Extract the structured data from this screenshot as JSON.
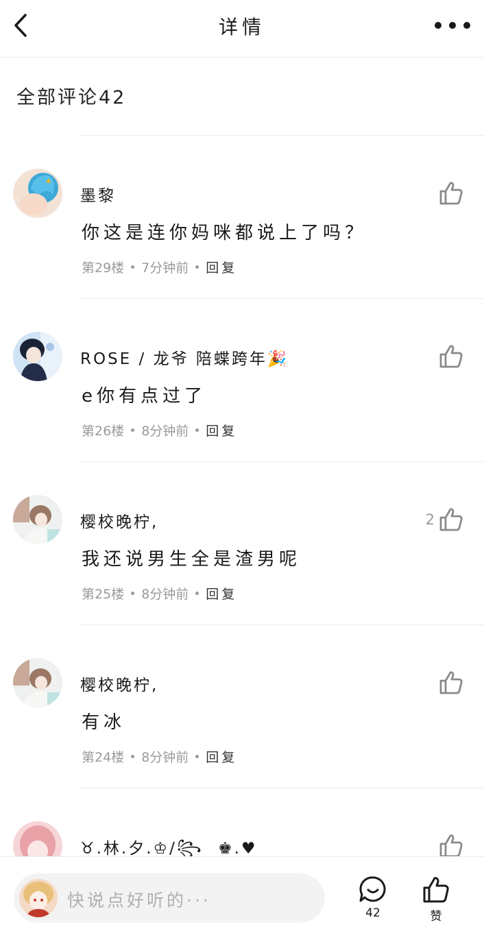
{
  "header": {
    "title": "详情"
  },
  "comments_header": "全部评论42",
  "comments": [
    {
      "username": "墨黎",
      "content": "你这是连你妈咪都说上了吗？",
      "floor": "第29楼",
      "time": "7分钟前",
      "reply_label": "回复",
      "like_count": ""
    },
    {
      "username": "ROSE / 龙爷 陪蝶跨年🎉",
      "content": "e你有点过了",
      "floor": "第26楼",
      "time": "8分钟前",
      "reply_label": "回复",
      "like_count": ""
    },
    {
      "username": "樱校晚柠,",
      "content": "我还说男生全是渣男呢",
      "floor": "第25楼",
      "time": "8分钟前",
      "reply_label": "回复",
      "like_count": "2"
    },
    {
      "username": "樱校晚柠,",
      "content": "有冰",
      "floor": "第24楼",
      "time": "8分钟前",
      "reply_label": "回复",
      "like_count": ""
    },
    {
      "username": "♉.林.夕.♔/꧂ㅤ♚.♥",
      "content": "",
      "floor": "",
      "time": "",
      "reply_label": "",
      "like_count": ""
    }
  ],
  "bottom_bar": {
    "input_placeholder": "快说点好听的···",
    "comment_count": "42",
    "like_label": "赞"
  },
  "colors": {
    "text_primary": "#1a1a1a",
    "text_secondary": "#9a9a9a",
    "divider": "#ececec",
    "input_bg": "#f3f3f3"
  },
  "icons": [
    "back-arrow-icon",
    "more-dots-icon",
    "thumbs-up-icon",
    "comment-bubble-icon"
  ]
}
